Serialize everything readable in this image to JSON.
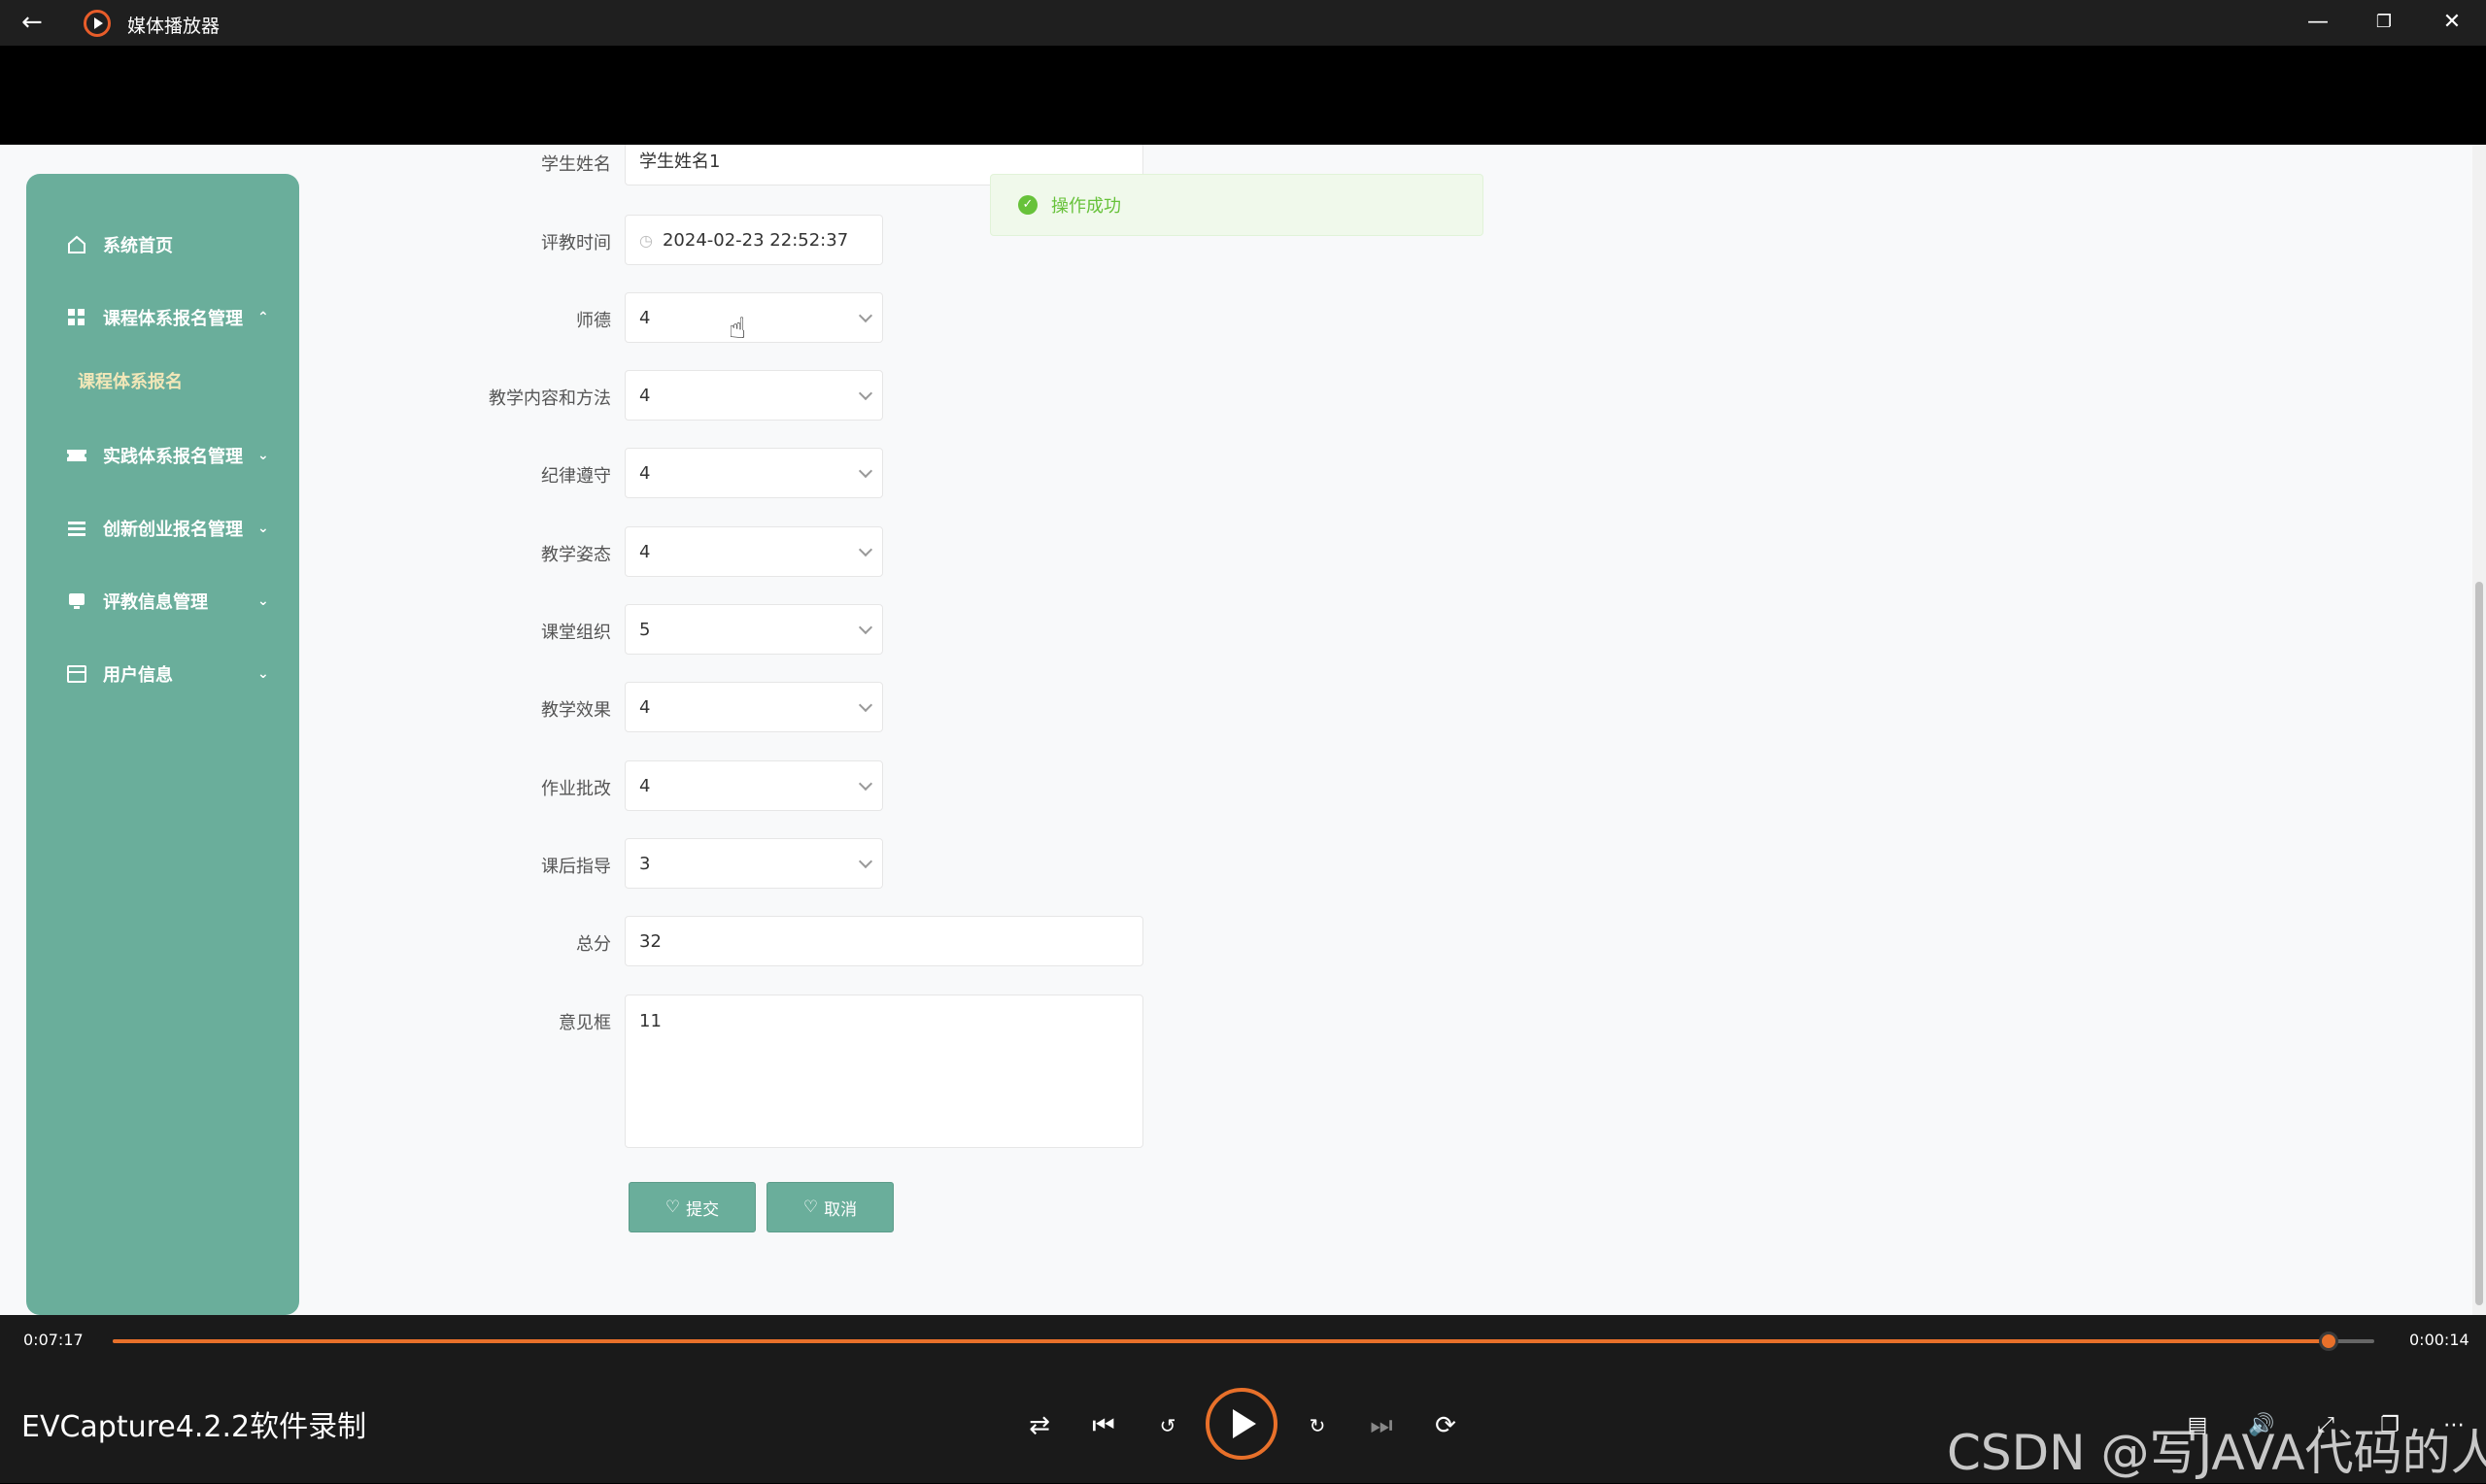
{
  "titlebar": {
    "app_title": "媒体播放器"
  },
  "sidebar": {
    "items": [
      {
        "label": "系统首页",
        "icon": "home-icon"
      },
      {
        "label": "课程体系报名管理",
        "icon": "grid-icon",
        "expanded": true
      },
      {
        "label": "实践体系报名管理",
        "icon": "ticket-icon"
      },
      {
        "label": "创新创业报名管理",
        "icon": "list-icon"
      },
      {
        "label": "评教信息管理",
        "icon": "monitor-icon"
      },
      {
        "label": "用户信息",
        "icon": "card-icon"
      }
    ],
    "subitem": "课程体系报名"
  },
  "form": {
    "student_name": {
      "label": "学生姓名",
      "value": "学生姓名1"
    },
    "eval_time": {
      "label": "评教时间",
      "value": "2024-02-23 22:52:37"
    },
    "selects": [
      {
        "label": "师德",
        "value": "4"
      },
      {
        "label": "教学内容和方法",
        "value": "4"
      },
      {
        "label": "纪律遵守",
        "value": "4"
      },
      {
        "label": "教学姿态",
        "value": "4"
      },
      {
        "label": "课堂组织",
        "value": "5"
      },
      {
        "label": "教学效果",
        "value": "4"
      },
      {
        "label": "作业批改",
        "value": "4"
      },
      {
        "label": "课后指导",
        "value": "3"
      }
    ],
    "total": {
      "label": "总分",
      "value": "32"
    },
    "comment": {
      "label": "意见框",
      "value": "11"
    },
    "submit_label": "提交",
    "cancel_label": "取消"
  },
  "toast": {
    "text": "操作成功"
  },
  "player": {
    "elapsed": "0:07:17",
    "remaining": "0:00:14",
    "progress": 0.98,
    "recorder_text": "EVCapture4.2.2软件录制",
    "watermark": "CSDN @写JAVA代码的人"
  },
  "colors": {
    "sidebar": "#6aae9b",
    "accent": "#e8702a",
    "success": "#67c23a"
  }
}
